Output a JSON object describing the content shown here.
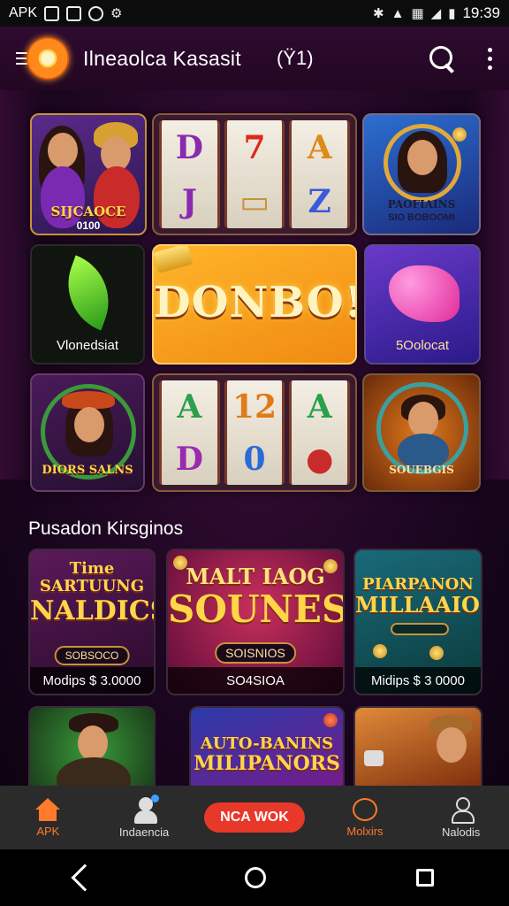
{
  "status_bar": {
    "left_text": "APK",
    "left_icons": [
      "image-icon",
      "camera-icon",
      "sync-icon",
      "android-icon"
    ],
    "right_icons": [
      "bluetooth-icon",
      "wifi-icon",
      "vibrate-icon",
      "signal-icon",
      "battery-icon"
    ],
    "time": "19:39"
  },
  "app_bar": {
    "title": "Ilneaolca Kasasit",
    "badge": "(Ÿ1)"
  },
  "game_grid": {
    "tiles": [
      {
        "caption": "SIJCAOCE",
        "subcaption": "0100"
      },
      {
        "reel1": [
          "D",
          "J"
        ],
        "reel2": [
          "7",
          "▭"
        ],
        "reel3": [
          "A",
          "Z"
        ]
      },
      {
        "caption": "PAOFIAINS",
        "subcaption": "SIO BOBOOMI"
      },
      {
        "caption": "Vlonedsiat"
      },
      {
        "caption": "DONBO!"
      },
      {
        "caption": "5Oolocat"
      },
      {
        "caption": "DIORS SALNS"
      },
      {
        "reel1": [
          "A",
          "D"
        ],
        "reel2": [
          "12",
          "0"
        ],
        "reel3": [
          "A",
          "●"
        ]
      },
      {
        "caption": "SOUEBGIS"
      }
    ]
  },
  "section": {
    "title": "Pusadon Kirsginos"
  },
  "cards": [
    {
      "title_small": "Time",
      "title_mid": "SARTUUNG",
      "title_big": "NALDICS",
      "pill": "SOBSOCO",
      "footer": "Modips $ 3.0000"
    },
    {
      "title_small": "MALT IAOG",
      "title_big": "SOUNES",
      "pill": "SOISNIOS",
      "footer": "SO4SIOA"
    },
    {
      "title_small": "PIARPANON",
      "title_big": "MILLAAIOS",
      "pill": "",
      "footer": "Midips $ 3 0000"
    },
    {
      "title_small": "",
      "title_big": "",
      "pill": "",
      "footer": ""
    },
    {
      "title_small": "AUTO-BANINS",
      "title_big": "MILIPANORS",
      "pill": "",
      "footer": ""
    },
    {
      "title_small": "",
      "title_big": "",
      "pill": "",
      "footer": ""
    }
  ],
  "bottom_nav": {
    "home_label": "APK",
    "notify_label": "Indaencia",
    "cta_label": "NCA WOK",
    "chat_label": "Molxirs",
    "profile_label": "Nalodis"
  },
  "colors": {
    "accent": "#ff7a2a",
    "cta": "#e8382a",
    "appbar": "#2e0a30"
  }
}
